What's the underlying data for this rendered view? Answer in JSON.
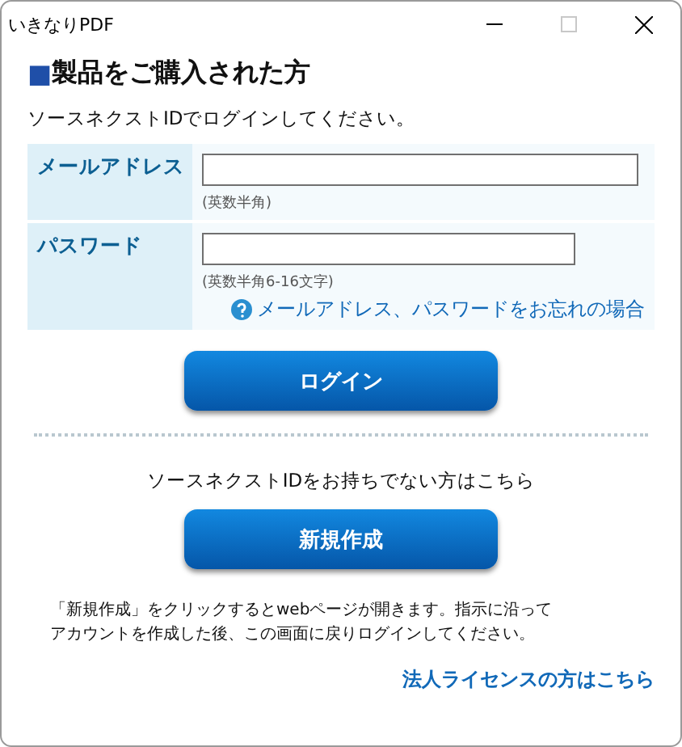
{
  "window": {
    "title": "いきなりPDF"
  },
  "heading": {
    "mark": "■",
    "text": "製品をご購入された方"
  },
  "intro": "ソースネクストIDでログインしてください。",
  "form": {
    "fields": [
      {
        "label": "メールアドレス",
        "hint": "(英数半角)",
        "kind": "wide"
      },
      {
        "label": "パスワード",
        "hint": "(英数半角6-16文字)",
        "kind": "narrow"
      }
    ],
    "forgot_link": "メールアドレス、パスワードをお忘れの場合"
  },
  "login_button": "ログイン",
  "no_id_text": "ソースネクストIDをお持ちでない方はこちら",
  "create_button": "新規作成",
  "note_lines": [
    "「新規作成」をクリックするとwebページが開きます。指示に沿って",
    "アカウントを作成した後、この画面に戻りログインしてください。"
  ],
  "corporate_link": "法人ライセンスの方はこちら"
}
